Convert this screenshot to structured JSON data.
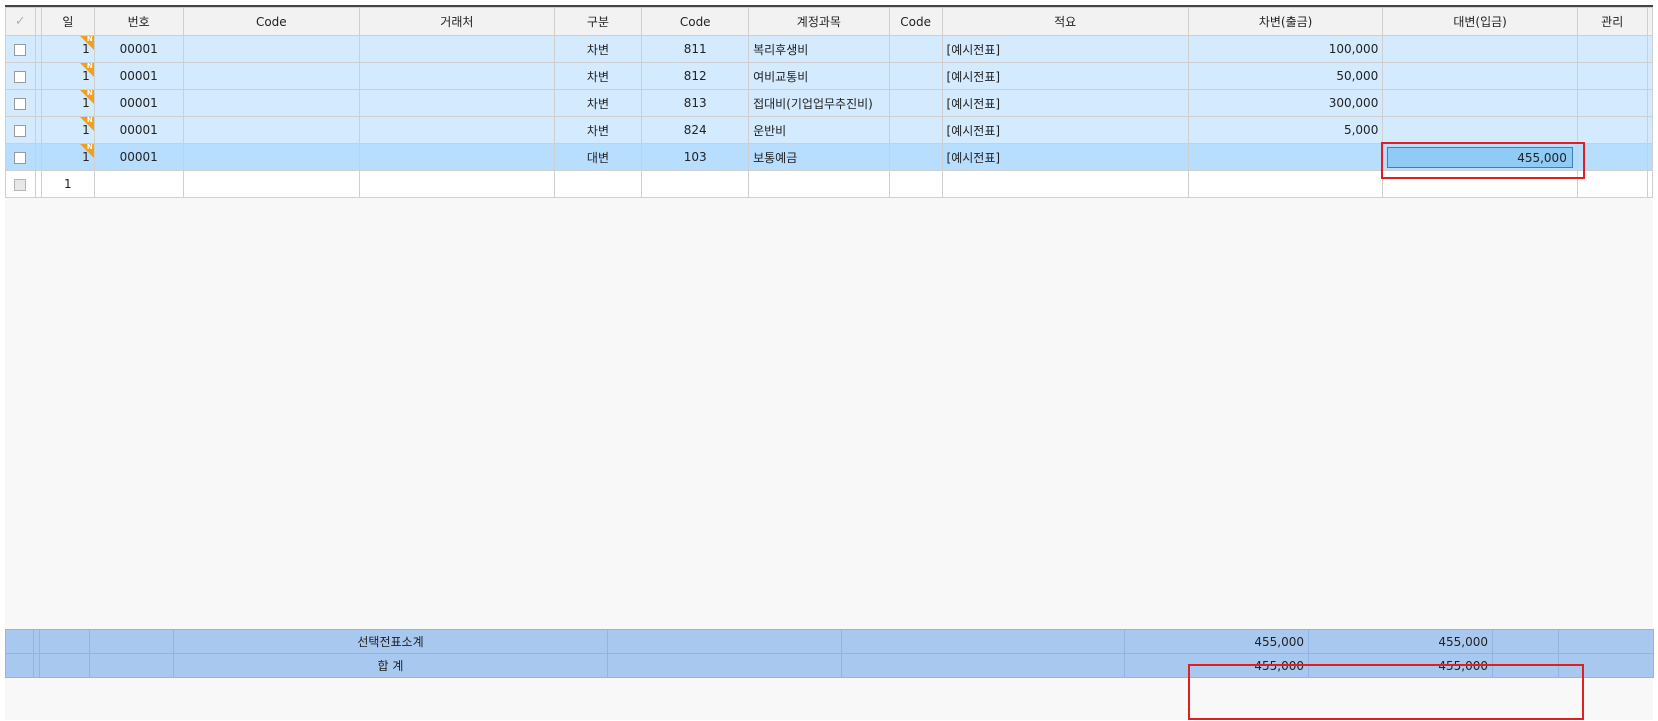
{
  "columns": {
    "day": "일",
    "number": "번호",
    "code1": "Code",
    "vendor": "거래처",
    "type": "구분",
    "code2": "Code",
    "account": "계정과목",
    "code3": "Code",
    "memo": "적요",
    "debit": "차변(출금)",
    "credit": "대변(입금)",
    "manage": "관리"
  },
  "flag_label": "N",
  "rows": [
    {
      "day": "1",
      "number": "00001",
      "type": "차변",
      "code": "811",
      "account": "복리후생비",
      "memo": "[예시전표]",
      "debit": "100,000",
      "credit": ""
    },
    {
      "day": "1",
      "number": "00001",
      "type": "차변",
      "code": "812",
      "account": "여비교통비",
      "memo": "[예시전표]",
      "debit": "50,000",
      "credit": ""
    },
    {
      "day": "1",
      "number": "00001",
      "type": "차변",
      "code": "813",
      "account": "접대비(기업업무추진비)",
      "memo": "[예시전표]",
      "debit": "300,000",
      "credit": ""
    },
    {
      "day": "1",
      "number": "00001",
      "type": "차변",
      "code": "824",
      "account": "운반비",
      "memo": "[예시전표]",
      "debit": "5,000",
      "credit": ""
    },
    {
      "day": "1",
      "number": "00001",
      "type": "대변",
      "code": "103",
      "account": "보통예금",
      "memo": "[예시전표]",
      "debit": "",
      "credit": "455,000"
    }
  ],
  "new_row": {
    "day": "1"
  },
  "footer": {
    "subtotal": {
      "label": "선택전표소계",
      "debit": "455,000",
      "credit": "455,000"
    },
    "total": {
      "label": "합 계",
      "debit": "455,000",
      "credit": "455,000"
    }
  },
  "colors": {
    "row_bg": "#d4ebff",
    "selected_row_bg": "#b7defe",
    "footer_bg": "#a8c8f0",
    "flag": "#f0a020",
    "highlight": "#e02020"
  }
}
